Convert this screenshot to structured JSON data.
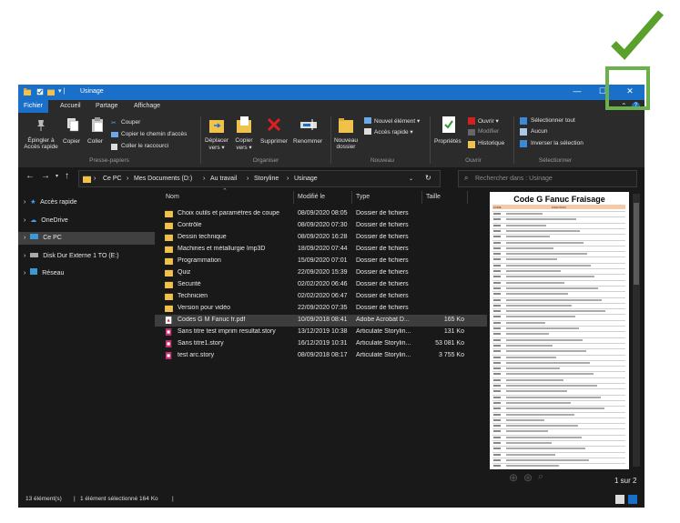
{
  "window": {
    "title": "Usinage",
    "controls": {
      "minimize": "—",
      "maximize": "☐",
      "close": "✕"
    }
  },
  "menu": {
    "tabs": [
      "Fichier",
      "Accueil",
      "Partage",
      "Affichage"
    ]
  },
  "ribbon": {
    "presse_papiers": {
      "pin": "Épingler à Accès rapide",
      "pin_l1": "Épingler à",
      "pin_l2": "Accès rapide",
      "copy": "Copier",
      "paste": "Coller",
      "cut": "Couper",
      "copy_path": "Copier le chemin d'accès",
      "paste_shortcut": "Coller le raccourci",
      "group": "Presse-papiers"
    },
    "organiser": {
      "move_l1": "Déplacer",
      "move_l2": "vers ▾",
      "copyto_l1": "Copier",
      "copyto_l2": "vers ▾",
      "delete": "Supprimer",
      "rename": "Renommer",
      "group": "Organiser"
    },
    "nouveau": {
      "new_folder_l1": "Nouveau",
      "new_folder_l2": "dossier",
      "new_item": "Nouvel élément ▾",
      "easy_access": "Accès rapide ▾",
      "group": "Nouveau"
    },
    "ouvrir": {
      "properties": "Propriétés",
      "open": "Ouvrir ▾",
      "edit": "Modifier",
      "history": "Historique",
      "group": "Ouvrir"
    },
    "selectionner": {
      "select_all": "Sélectionner tout",
      "none": "Aucun",
      "invert": "Inverser la sélection",
      "group": "Sélectionner"
    }
  },
  "address": {
    "crumbs": [
      "Ce PC",
      "Mes Documents (D:)",
      "Au travail",
      "Storyline",
      "Usinage"
    ],
    "search_placeholder": "Rechercher dans : Usinage"
  },
  "nav": {
    "items": [
      "Accès rapide",
      "OneDrive",
      "Ce PC",
      "Disk Dur Externe 1 TO (E:)",
      "Réseau"
    ]
  },
  "columns": {
    "name": "Nom",
    "modified": "Modifié le",
    "type": "Type",
    "size": "Taille"
  },
  "files": [
    {
      "name": "Choix outils et paramètres de coupe",
      "modified": "08/09/2020 08:05",
      "type": "Dossier de fichiers",
      "size": "",
      "icon": "folder"
    },
    {
      "name": "Contrôle",
      "modified": "08/09/2020 07:30",
      "type": "Dossier de fichiers",
      "size": "",
      "icon": "folder"
    },
    {
      "name": "Dessin technique",
      "modified": "08/09/2020 16:28",
      "type": "Dossier de fichiers",
      "size": "",
      "icon": "folder"
    },
    {
      "name": "Machines et métallurgie Imp3D",
      "modified": "18/09/2020 07:44",
      "type": "Dossier de fichiers",
      "size": "",
      "icon": "folder"
    },
    {
      "name": "Programmation",
      "modified": "15/09/2020 07:01",
      "type": "Dossier de fichiers",
      "size": "",
      "icon": "folder"
    },
    {
      "name": "Quiz",
      "modified": "22/09/2020 15:39",
      "type": "Dossier de fichiers",
      "size": "",
      "icon": "folder"
    },
    {
      "name": "Securité",
      "modified": "02/02/2020 06:46",
      "type": "Dossier de fichiers",
      "size": "",
      "icon": "folder"
    },
    {
      "name": "Technicien",
      "modified": "02/02/2020 06:47",
      "type": "Dossier de fichiers",
      "size": "",
      "icon": "folder"
    },
    {
      "name": "Version pour vidéo",
      "modified": "22/09/2020 07:35",
      "type": "Dossier de fichiers",
      "size": "",
      "icon": "folder"
    },
    {
      "name": "Codes G M Fanuc fr.pdf",
      "modified": "10/09/2018 08:41",
      "type": "Adobe Acrobat D...",
      "size": "165 Ko",
      "icon": "pdf"
    },
    {
      "name": "Sans titre test imprim resultat.story",
      "modified": "13/12/2019 10:38",
      "type": "Articulate Storylin...",
      "size": "131 Ko",
      "icon": "story"
    },
    {
      "name": "Sans titre1.story",
      "modified": "16/12/2019 10:31",
      "type": "Articulate Storylin...",
      "size": "53 081 Ko",
      "icon": "story"
    },
    {
      "name": "test arc.story",
      "modified": "08/09/2018 08:17",
      "type": "Articulate Storylin...",
      "size": "3 755 Ko",
      "icon": "story"
    }
  ],
  "selected_index": 9,
  "preview": {
    "title": "Code G Fanuc Fraisage",
    "header_code": "CODE",
    "header_func": "FONCTION",
    "page_counter": "1 sur 2"
  },
  "status": {
    "count": "13 élément(s)",
    "selection": "1 élément sélectionné  164 Ko"
  },
  "colors": {
    "accent": "#1a6fc8",
    "check_green": "#5aa02c",
    "highlight_box": "#6ab04c",
    "folder": "#f0c24b"
  }
}
